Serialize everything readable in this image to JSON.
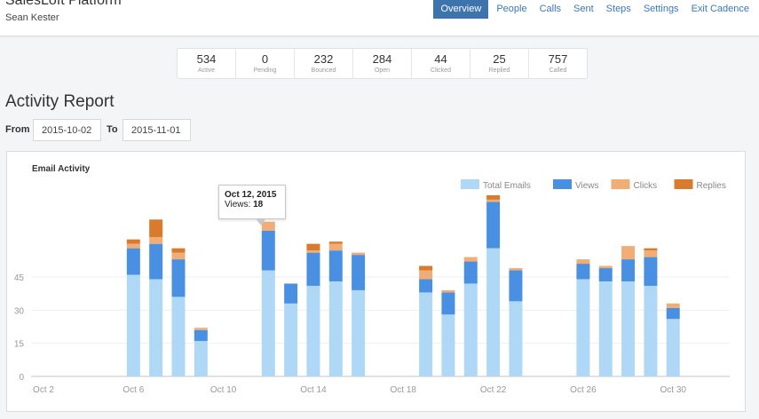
{
  "header": {
    "title": "SalesLoft Platform",
    "user": "Sean Kester",
    "nav": [
      {
        "label": "Overview",
        "active": true
      },
      {
        "label": "People"
      },
      {
        "label": "Calls"
      },
      {
        "label": "Sent"
      },
      {
        "label": "Steps"
      },
      {
        "label": "Settings"
      },
      {
        "label": "Exit Cadence"
      }
    ]
  },
  "stats": [
    {
      "value": "534",
      "label": "Active"
    },
    {
      "value": "0",
      "label": "Pending"
    },
    {
      "value": "232",
      "label": "Bounced"
    },
    {
      "value": "284",
      "label": "Open"
    },
    {
      "value": "44",
      "label": "Clicked"
    },
    {
      "value": "25",
      "label": "Replied"
    },
    {
      "value": "757",
      "label": "Called"
    }
  ],
  "report": {
    "title": "Activity Report",
    "from_label": "From",
    "from_value": "2015-10-02",
    "to_label": "To",
    "to_value": "2015-11-01"
  },
  "tooltip": {
    "date": "Oct 12, 2015",
    "label": "Views: ",
    "value": "18"
  },
  "chart_data": {
    "type": "bar",
    "stacked": true,
    "title": "Email Activity",
    "grid": true,
    "legend": "top-right",
    "ylim": [
      0,
      85
    ],
    "yticks": [
      0,
      15,
      30,
      45
    ],
    "xticks": [
      "Oct 2",
      "Oct 6",
      "Oct 10",
      "Oct 14",
      "Oct 18",
      "Oct 22",
      "Oct 26",
      "Oct 30"
    ],
    "categories": [
      "Oct 2",
      "Oct 3",
      "Oct 4",
      "Oct 5",
      "Oct 6",
      "Oct 7",
      "Oct 8",
      "Oct 9",
      "Oct 10",
      "Oct 11",
      "Oct 12",
      "Oct 13",
      "Oct 14",
      "Oct 15",
      "Oct 16",
      "Oct 17",
      "Oct 18",
      "Oct 19",
      "Oct 20",
      "Oct 21",
      "Oct 22",
      "Oct 23",
      "Oct 24",
      "Oct 25",
      "Oct 26",
      "Oct 27",
      "Oct 28",
      "Oct 29",
      "Oct 30",
      "Oct 31",
      "Nov 1"
    ],
    "series": [
      {
        "name": "Total Emails",
        "color": "#aed8f6",
        "values": [
          0,
          0,
          0,
          0,
          46,
          44,
          36,
          16,
          0,
          0,
          48,
          33,
          41,
          43,
          39,
          0,
          0,
          38,
          28,
          42,
          58,
          34,
          0,
          0,
          44,
          43,
          43,
          41,
          26,
          0,
          0
        ]
      },
      {
        "name": "Views",
        "color": "#4a90e2",
        "values": [
          0,
          0,
          0,
          0,
          12,
          16,
          17,
          5,
          0,
          0,
          18,
          9,
          15,
          14,
          16,
          0,
          0,
          6,
          10,
          10,
          21,
          14,
          0,
          0,
          7,
          6,
          10,
          13,
          5,
          0,
          0
        ]
      },
      {
        "name": "Clicks",
        "color": "#f0ae76",
        "values": [
          0,
          0,
          0,
          0,
          2,
          3,
          3,
          1,
          0,
          0,
          4,
          0,
          1,
          3,
          1,
          0,
          0,
          4,
          1,
          2,
          1,
          1,
          0,
          0,
          2,
          1,
          6,
          3,
          2,
          0,
          0
        ]
      },
      {
        "name": "Replies",
        "color": "#d97b2c",
        "values": [
          0,
          0,
          0,
          0,
          2,
          8,
          2,
          0,
          0,
          0,
          0,
          0,
          3,
          1,
          0,
          0,
          0,
          2,
          0,
          0,
          2,
          0,
          0,
          0,
          0,
          0,
          0,
          1,
          0,
          0,
          0
        ]
      }
    ]
  }
}
